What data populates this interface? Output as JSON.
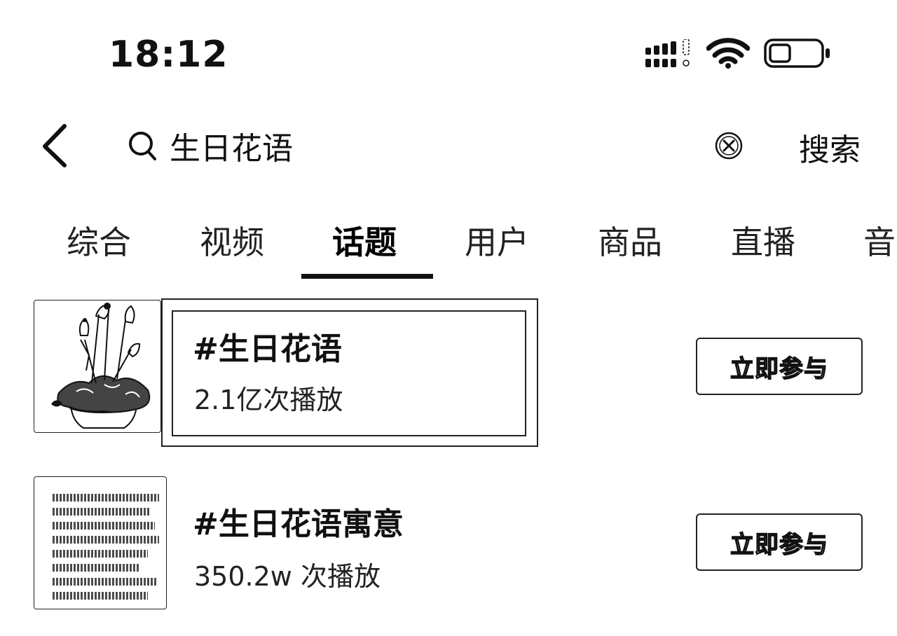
{
  "status_bar": {
    "time": "18:12"
  },
  "search": {
    "query": "生日花语",
    "search_label": "搜索"
  },
  "tabs": [
    {
      "label": "综合"
    },
    {
      "label": "视频"
    },
    {
      "label": "话题"
    },
    {
      "label": "用户"
    },
    {
      "label": "商品"
    },
    {
      "label": "直播"
    },
    {
      "label": "音"
    }
  ],
  "active_tab": "话题",
  "results": [
    {
      "title": "#生日花语",
      "plays": "2.1亿次播放",
      "join_label": "立即参与"
    },
    {
      "title": "#生日花语寓意",
      "plays": "350.2w 次播放",
      "join_label": "立即参与"
    }
  ]
}
